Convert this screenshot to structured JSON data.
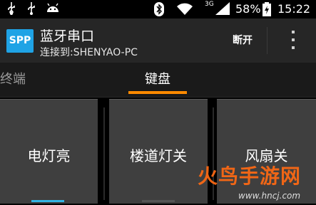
{
  "status_bar": {
    "battery_percent": "58%",
    "time": "15:22",
    "network_type": "3G",
    "icons": [
      "usb-icon",
      "usb-icon",
      "android-icon",
      "bluetooth-icon",
      "wifi-icon",
      "signal-icon",
      "battery-charging-icon"
    ]
  },
  "action_bar": {
    "app_icon_label": "SPP",
    "title": "蓝牙串口",
    "subtitle": "连接到:SHENYAO-PC",
    "disconnect_label": "断开",
    "overflow_icon": "more-vert-icon",
    "icon_color": "#1fa3e5"
  },
  "tabs": [
    {
      "label": "终端",
      "selected": false
    },
    {
      "label": "键盘",
      "selected": true
    }
  ],
  "tab_indicator_color": "#ff8a00",
  "buttons": [
    {
      "label": "电灯亮"
    },
    {
      "label": "楼道灯关"
    },
    {
      "label": "风扇关"
    }
  ],
  "press_indicator_color": "#33b5e5",
  "watermark": {
    "logo_text": "火鸟手游网",
    "url": "www.hncj.com"
  }
}
